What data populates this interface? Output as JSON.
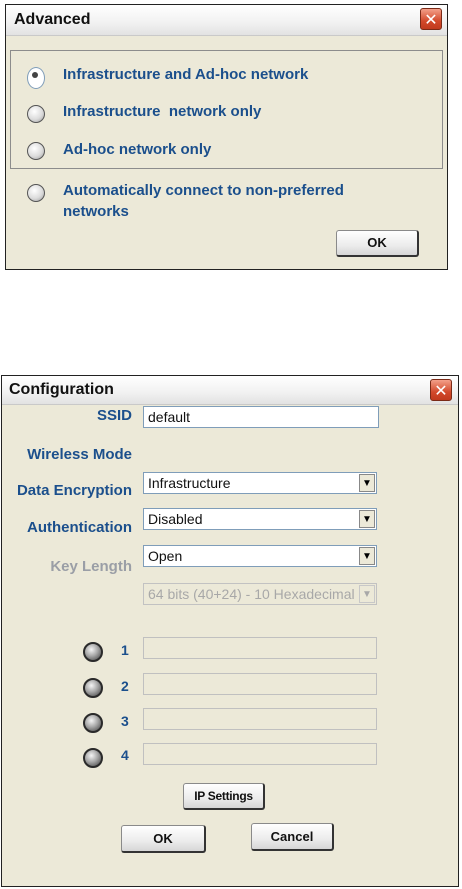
{
  "advanced": {
    "title": "Advanced",
    "options": [
      {
        "label": "Infrastructure and Ad-hoc network",
        "selected": true
      },
      {
        "label": "Infrastructure  network only",
        "selected": false
      },
      {
        "label": "Ad-hoc network only",
        "selected": false
      }
    ],
    "auto_connect": {
      "line1": "Automatically connect to non-preferred",
      "line2": "networks"
    },
    "ok_label": "OK"
  },
  "configuration": {
    "title": "Configuration",
    "ssid": {
      "label": "SSID",
      "value": "default"
    },
    "wireless_mode": {
      "label": "Wireless Mode",
      "value": "Infrastructure"
    },
    "data_encryption": {
      "label": "Data Encryption",
      "value": "Disabled"
    },
    "authentication": {
      "label": "Authentication",
      "value": "Open"
    },
    "key_length": {
      "label": "Key Length",
      "value": "64 bits (40+24) - 10 Hexadecimal"
    },
    "keys": [
      {
        "label": "1"
      },
      {
        "label": "2"
      },
      {
        "label": "3"
      },
      {
        "label": "4"
      }
    ],
    "ip_settings_label": "IP Settings",
    "ok_label": "OK",
    "cancel_label": "Cancel"
  },
  "icons": {
    "close": "close-icon",
    "dropdown": "chevron-down-icon"
  }
}
